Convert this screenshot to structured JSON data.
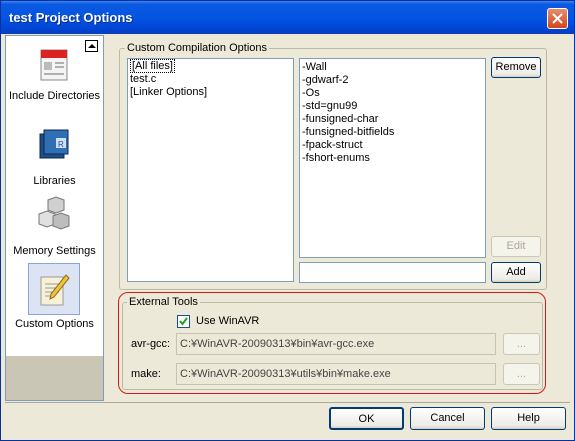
{
  "window": {
    "title": "test Project Options",
    "close_icon": "close-icon"
  },
  "sidebar": {
    "items": [
      {
        "label": "Include Directories",
        "icon": "include-directories-icon"
      },
      {
        "label": "Libraries",
        "icon": "libraries-icon"
      },
      {
        "label": "Memory Settings",
        "icon": "memory-settings-icon"
      },
      {
        "label": "Custom Options",
        "icon": "custom-options-icon",
        "selected": true
      }
    ]
  },
  "compilation": {
    "group_label": "Custom Compilation Options",
    "files": [
      "[All files]",
      "test.c",
      "[Linker Options]"
    ],
    "options": [
      "-Wall",
      "-gdwarf-2",
      "-Os",
      "-std=gnu99",
      "-funsigned-char",
      "-funsigned-bitfields",
      "-fpack-struct",
      "-fshort-enums"
    ],
    "new_option_value": "",
    "remove_label": "Remove",
    "edit_label": "Edit",
    "add_label": "Add"
  },
  "external": {
    "group_label": "External Tools",
    "use_winavr_label": "Use WinAVR",
    "use_winavr_checked": true,
    "avrgcc_label": "avr-gcc:",
    "avrgcc_path": "C:¥WinAVR-20090313¥bin¥avr-gcc.exe",
    "make_label": "make:",
    "make_path": "C:¥WinAVR-20090313¥utils¥bin¥make.exe",
    "browse_label": "..."
  },
  "footer": {
    "ok_label": "OK",
    "cancel_label": "Cancel",
    "help_label": "Help"
  }
}
